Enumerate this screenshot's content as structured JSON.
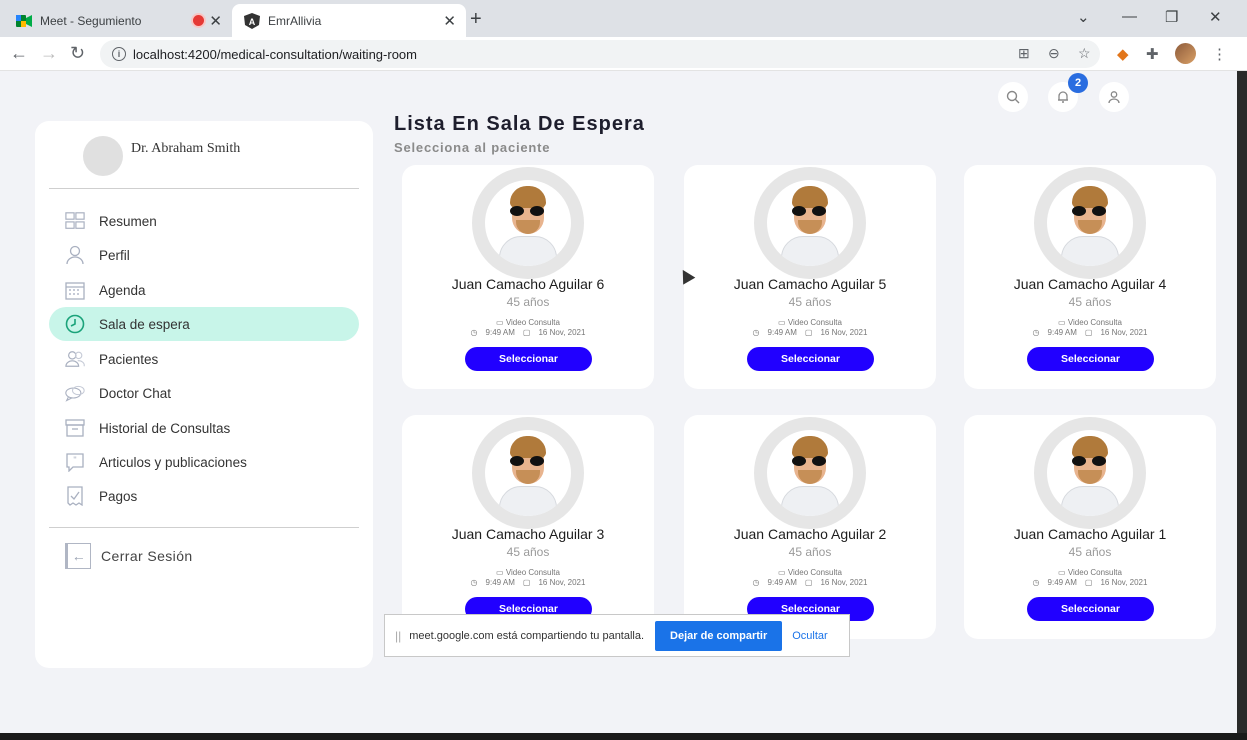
{
  "browser": {
    "tabs": [
      {
        "title": "Meet - Segumiento",
        "recording": true
      },
      {
        "title": "EmrAllivia",
        "active": true
      }
    ],
    "url": "localhost:4200/medical-consultation/waiting-room"
  },
  "header": {
    "notifications_count": "2"
  },
  "sidebar": {
    "doctor_name": "Dr. Abraham Smith",
    "items": [
      {
        "label": "Resumen",
        "icon": "dashboard-icon"
      },
      {
        "label": "Perfil",
        "icon": "user-icon"
      },
      {
        "label": "Agenda",
        "icon": "calendar-icon"
      },
      {
        "label": "Sala de espera",
        "icon": "clock-icon",
        "active": true
      },
      {
        "label": "Pacientes",
        "icon": "patients-icon"
      },
      {
        "label": "Doctor Chat",
        "icon": "chat-icon"
      },
      {
        "label": "Historial de Consultas",
        "icon": "archive-icon"
      },
      {
        "label": "Articulos y publicaciones",
        "icon": "quote-icon"
      },
      {
        "label": "Pagos",
        "icon": "payment-icon"
      }
    ],
    "logout_label": "Cerrar Sesión"
  },
  "main": {
    "title": "Lista En Sala De Espera",
    "subtitle": "Selecciona al paciente",
    "patients": [
      {
        "name": "Juan Camacho Aguilar 6",
        "age": "45 años",
        "type": "Video Consulta",
        "time": "9:49 AM",
        "date": "16 Nov, 2021",
        "button": "Seleccionar"
      },
      {
        "name": "Juan Camacho Aguilar 5",
        "age": "45 años",
        "type": "Video Consulta",
        "time": "9:49 AM",
        "date": "16 Nov, 2021",
        "button": "Seleccionar"
      },
      {
        "name": "Juan Camacho Aguilar 4",
        "age": "45 años",
        "type": "Video Consulta",
        "time": "9:49 AM",
        "date": "16 Nov, 2021",
        "button": "Seleccionar"
      },
      {
        "name": "Juan Camacho Aguilar 3",
        "age": "45 años",
        "type": "Video Consulta",
        "time": "9:49 AM",
        "date": "16 Nov, 2021",
        "button": "Seleccionar"
      },
      {
        "name": "Juan Camacho Aguilar 2",
        "age": "45 años",
        "type": "Video Consulta",
        "time": "9:49 AM",
        "date": "16 Nov, 2021",
        "button": "Seleccionar"
      },
      {
        "name": "Juan Camacho Aguilar 1",
        "age": "45 años",
        "type": "Video Consulta",
        "time": "9:49 AM",
        "date": "16 Nov, 2021",
        "button": "Seleccionar"
      }
    ]
  },
  "share_bar": {
    "message": "meet.google.com está compartiendo tu pantalla.",
    "stop_label": "Dejar de compartir",
    "hide_label": "Ocultar"
  },
  "colors": {
    "primary_button": "#2100ff",
    "active_menu": "#c8f5e9",
    "badge": "#2a6de0"
  }
}
